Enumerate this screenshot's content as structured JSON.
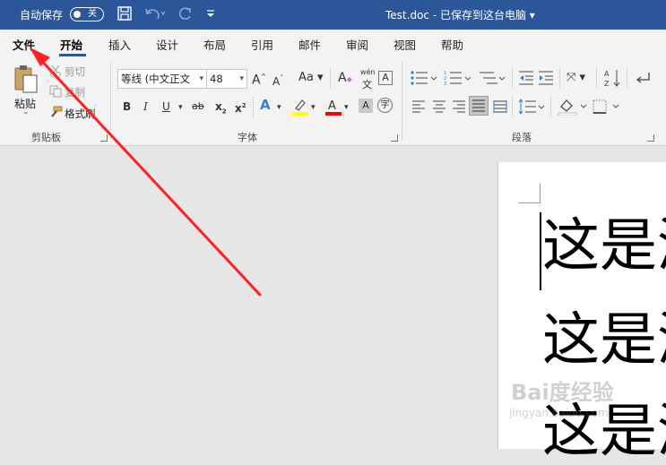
{
  "titlebar": {
    "autosave_label": "自动保存",
    "autosave_state": "关",
    "doc_title": "Test.doc  -  已保存到这台电脑  ▾",
    "color": "#2b579a"
  },
  "menu": {
    "items": [
      {
        "label": "文件"
      },
      {
        "label": "开始"
      },
      {
        "label": "插入"
      },
      {
        "label": "设计"
      },
      {
        "label": "布局"
      },
      {
        "label": "引用"
      },
      {
        "label": "邮件"
      },
      {
        "label": "审阅"
      },
      {
        "label": "视图"
      },
      {
        "label": "帮助"
      }
    ],
    "active": "开始"
  },
  "ribbon": {
    "clipboard": {
      "paste_label": "粘贴",
      "cut_label": "剪切",
      "copy_label": "复制",
      "format_painter_label": "格式刷",
      "group_label": "剪贴板"
    },
    "font": {
      "font_name": "等线 (中文正文",
      "font_size": "48",
      "group_label": "字体",
      "wen_top": "wén",
      "wen_bottom": "文",
      "highlight_color": "#ffff00",
      "font_color": "#ff0000"
    },
    "paragraph": {
      "group_label": "段落"
    }
  },
  "document": {
    "lines": [
      "这是测",
      "这是测",
      "这是测"
    ]
  },
  "watermark": {
    "text": "Bai度经验",
    "sub": "jingyan.baidu.com"
  },
  "annotation": {
    "arrow_color": "#ff2020"
  }
}
